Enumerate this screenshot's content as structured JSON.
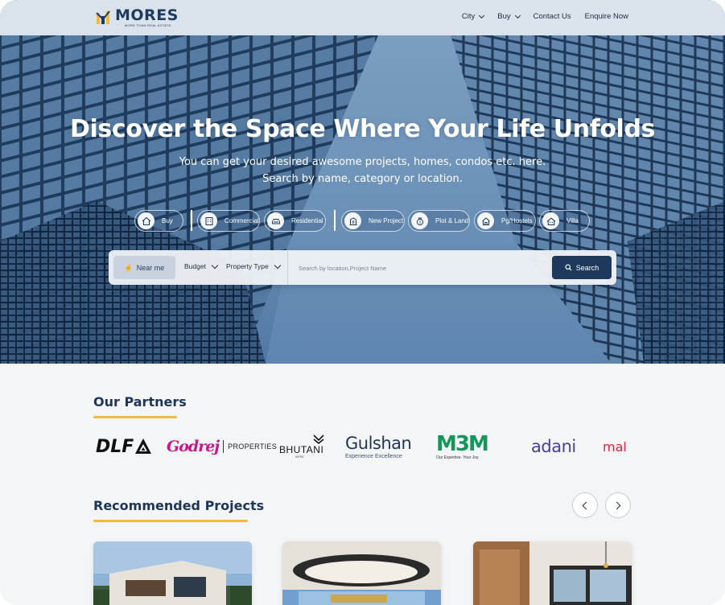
{
  "brand": {
    "name": "MORES",
    "tagline": "MORE THAN REAL ESTATE"
  },
  "nav": {
    "items": [
      {
        "label": "City",
        "has_dropdown": true
      },
      {
        "label": "Buy",
        "has_dropdown": true
      },
      {
        "label": "Contact Us",
        "has_dropdown": false
      },
      {
        "label": "Enquire Now",
        "has_dropdown": false
      }
    ]
  },
  "hero": {
    "title": "Discover the Space Where Your Life Unfolds",
    "subtitle_line1": "You can get your desired awesome projects, homes, condos etc. here.",
    "subtitle_line2": "Search by name, category or location."
  },
  "categories": [
    {
      "label": "Buy",
      "icon": "home-icon"
    },
    {
      "label": "Commercial",
      "icon": "building-icon"
    },
    {
      "label": "Residential",
      "icon": "sofa-icon"
    },
    {
      "label": "New Project",
      "icon": "project-icon"
    },
    {
      "label": "Plot & Land",
      "icon": "money-bag-icon"
    },
    {
      "label": "Pg/Hostels",
      "icon": "hostel-icon"
    },
    {
      "label": "Villa",
      "icon": "villa-icon"
    }
  ],
  "search": {
    "near_me_label": "Near me",
    "budget_label": "Budget",
    "property_type_label": "Property Type",
    "placeholder": "Search by location,Project Name",
    "button_label": "Search"
  },
  "partners": {
    "title": "Our Partners",
    "logos": [
      {
        "name": "DLF",
        "text": "DLF"
      },
      {
        "name": "Godrej Properties",
        "script": "Godrej",
        "text": "PROPERTIES"
      },
      {
        "name": "Bhutani",
        "text": "BHUTANI",
        "sub": "INFRA"
      },
      {
        "name": "Gulshan",
        "text": "Gulshan",
        "sub": "Experience Excellence"
      },
      {
        "name": "M3M",
        "text": "M3M",
        "sub": "Our Expertise. Your Joy."
      },
      {
        "name": "Adani",
        "text": "adani"
      },
      {
        "name": "Mahagun",
        "text": "mal"
      }
    ]
  },
  "recommended": {
    "title": "Recommended Projects",
    "prev_label": "previous",
    "next_label": "next"
  },
  "colors": {
    "brand_navy": "#1d3a5c",
    "accent_gold": "#f2b93b",
    "page_bg": "#f4f5f6"
  }
}
